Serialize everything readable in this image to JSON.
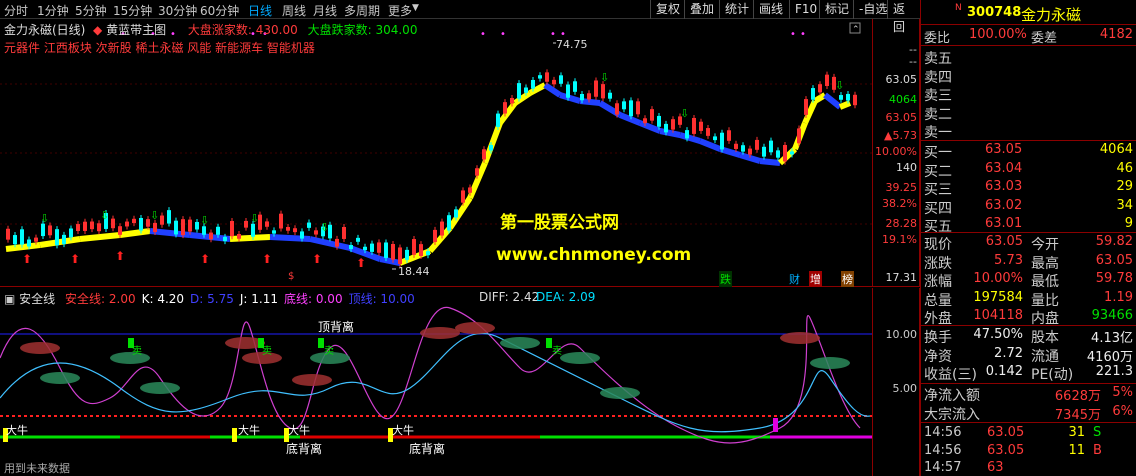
{
  "topbar": {
    "periods": [
      "分时",
      "1分钟",
      "5分钟",
      "15分钟",
      "30分钟",
      "60分钟",
      "日线",
      "周线",
      "月线",
      "多周期",
      "更多"
    ],
    "active_period": "日线",
    "buttons": [
      "复权",
      "叠加",
      "统计",
      "画线",
      "F10",
      "标记",
      "-自选",
      "返回"
    ]
  },
  "main_chart": {
    "stock_label": "金力永磁(日线)",
    "indicator_name": "黄蓝带主图",
    "up_count_label": "大盘涨家数: 430.00",
    "down_count_label": "大盘跌家数: 304.00",
    "sectors": "元器件 江西板块 次新股 稀土永磁 风能 新能源车 智能机器",
    "high_label": "74.75",
    "low_label": "18.44",
    "scale": [
      "63.05",
      "4064",
      "63.05",
      "▲5.73",
      "10.00%",
      "140",
      "39.25",
      "38.2%",
      "28.28",
      "19.1%",
      "17.31"
    ],
    "watermark1": "第一股票公式网",
    "watermark2": "www.chnmoney.com",
    "markers": [
      "跌",
      "财",
      "增",
      "榜",
      "$"
    ]
  },
  "sub_chart": {
    "name": "安全线",
    "params": [
      {
        "text": "安全线: 2.00",
        "color": "#ff3b3b"
      },
      {
        "text": "K: 4.20",
        "color": "#ffffff"
      },
      {
        "text": "D: 5.75",
        "color": "#4040ff"
      },
      {
        "text": "J: 1.11",
        "color": "#ffffff"
      },
      {
        "text": "底线: 0.00",
        "color": "#ff40ff"
      },
      {
        "text": "顶线: 10.00",
        "color": "#4040ff"
      }
    ],
    "diff_label": "DIFF: 2.42",
    "dea_label": "DEA: 2.09",
    "scale": [
      "10.00",
      "5.00"
    ],
    "top_divergence": "顶背离",
    "bottom_divergence": "底背离",
    "bull": "大牛",
    "sell": "卖",
    "footer": "用到未来数据"
  },
  "quote": {
    "code": "300748",
    "name": "金力永磁",
    "wei_bi_label": "委比",
    "wei_bi": "100.00%",
    "wei_cha_label": "委差",
    "wei_cha": "4182",
    "sell": [
      {
        "label": "卖五",
        "price": "",
        "vol": ""
      },
      {
        "label": "卖四",
        "price": "",
        "vol": ""
      },
      {
        "label": "卖三",
        "price": "",
        "vol": ""
      },
      {
        "label": "卖二",
        "price": "",
        "vol": ""
      },
      {
        "label": "卖一",
        "price": "",
        "vol": ""
      }
    ],
    "buy": [
      {
        "label": "买一",
        "price": "63.05",
        "vol": "4064"
      },
      {
        "label": "买二",
        "price": "63.04",
        "vol": "46"
      },
      {
        "label": "买三",
        "price": "63.03",
        "vol": "29"
      },
      {
        "label": "买四",
        "price": "63.02",
        "vol": "34"
      },
      {
        "label": "买五",
        "price": "63.01",
        "vol": "9"
      }
    ],
    "stats": [
      {
        "l1": "现价",
        "v1": "63.05",
        "c1": "red",
        "l2": "今开",
        "v2": "59.82",
        "c2": "red"
      },
      {
        "l1": "涨跌",
        "v1": "5.73",
        "c1": "red",
        "l2": "最高",
        "v2": "63.05",
        "c2": "red"
      },
      {
        "l1": "涨幅",
        "v1": "10.00%",
        "c1": "red",
        "l2": "最低",
        "v2": "59.78",
        "c2": "red"
      },
      {
        "l1": "总量",
        "v1": "197584",
        "c1": "yel",
        "l2": "量比",
        "v2": "1.19",
        "c2": "red"
      },
      {
        "l1": "外盘",
        "v1": "104118",
        "c1": "red",
        "l2": "内盘",
        "v2": "93466",
        "c2": "grn"
      }
    ],
    "stats2": [
      {
        "l1": "换手",
        "v1": "47.50%",
        "c1": "wht",
        "l2": "股本",
        "v2": "4.13亿",
        "c2": "wht"
      },
      {
        "l1": "净资",
        "v1": "2.72",
        "c1": "wht",
        "l2": "流通",
        "v2": "4160万",
        "c2": "wht"
      },
      {
        "l1": "收益(三)",
        "v1": "0.142",
        "c1": "wht",
        "l2": "PE(动)",
        "v2": "221.3",
        "c2": "wht"
      }
    ],
    "flows": [
      {
        "label": "净流入额",
        "value": "6628万",
        "pct": "5%"
      },
      {
        "label": "大宗流入",
        "value": "7345万",
        "pct": "6%"
      }
    ],
    "ticks": [
      {
        "time": "14:56",
        "price": "63.05",
        "vol": "31",
        "flag": "S"
      },
      {
        "time": "14:56",
        "price": "63.05",
        "vol": "11",
        "flag": "B"
      },
      {
        "time": "14:57",
        "price": "63",
        "vol": "",
        "": ""
      }
    ]
  }
}
